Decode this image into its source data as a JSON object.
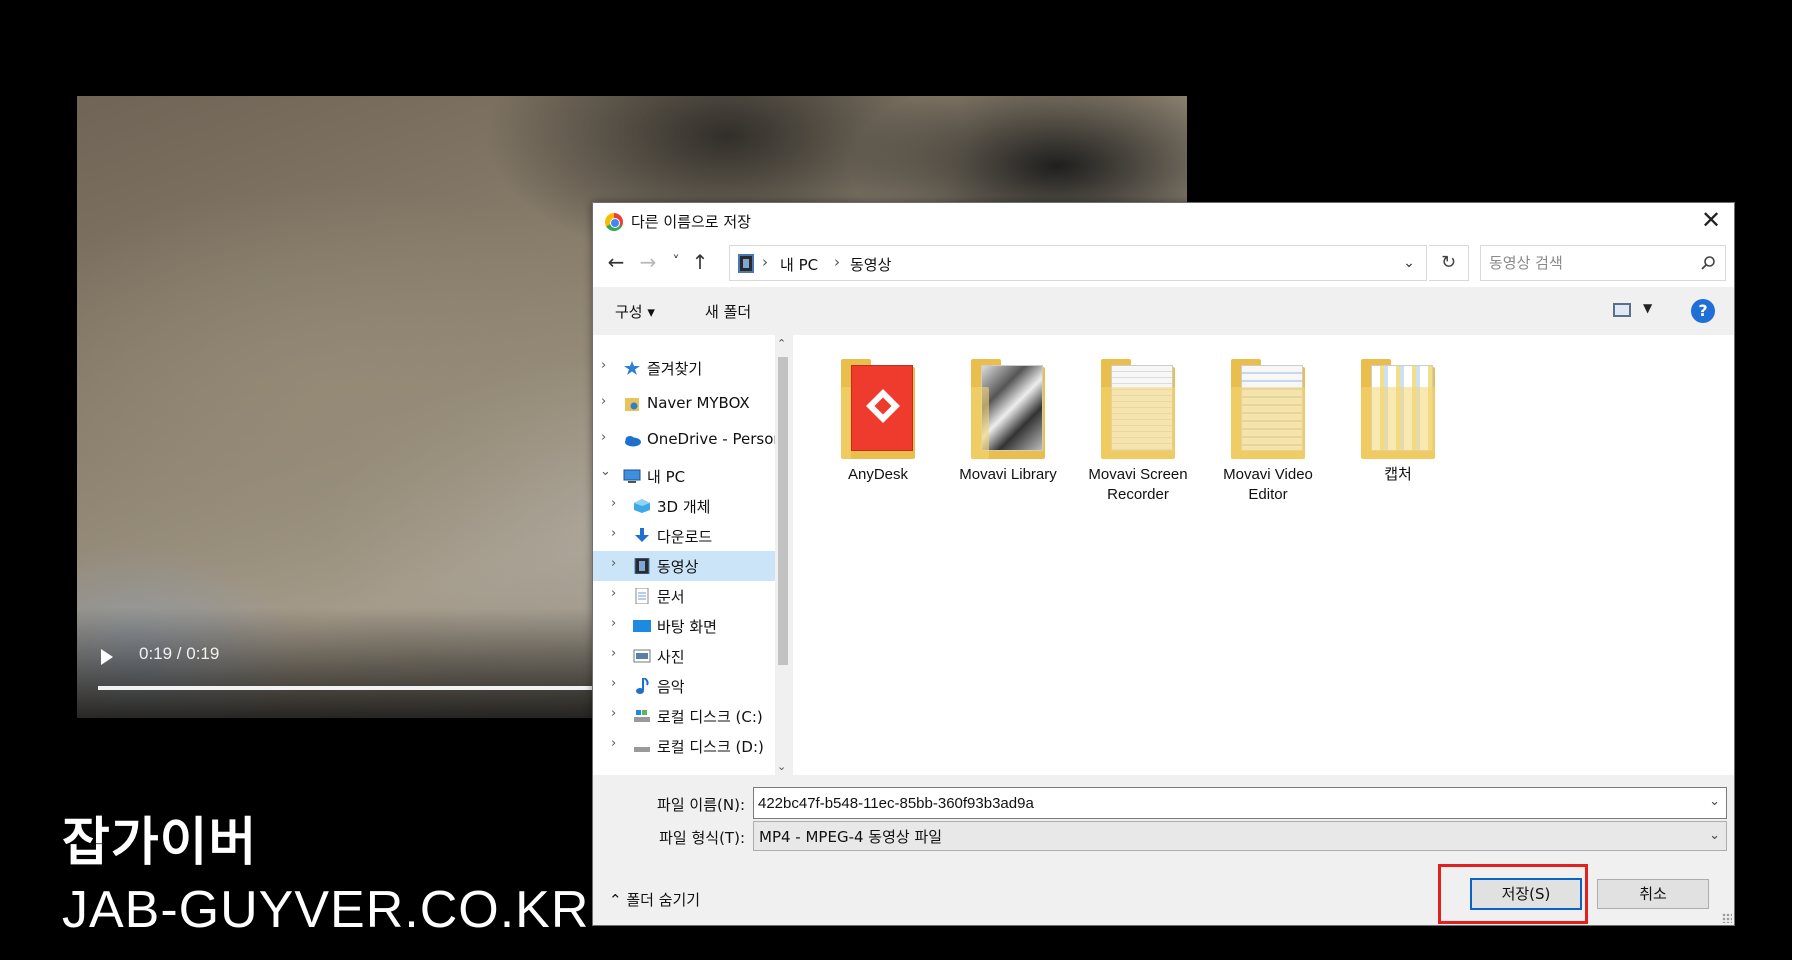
{
  "video": {
    "time": "0:19 / 0:19",
    "progress_fraction": 1.0
  },
  "watermark": {
    "title": "잡가이버",
    "url": "JAB-GUYVER.CO.KR"
  },
  "dialog": {
    "title": "다른 이름으로 저장",
    "close_glyph": "✕",
    "nav": {
      "back_glyph": "←",
      "forward_glyph": "→",
      "recent_glyph": "˅",
      "up_glyph": "↑",
      "breadcrumb": [
        "내 PC",
        "동영상"
      ],
      "crumb_sep": "›",
      "refresh_glyph": "↻",
      "dropdown_glyph": "⌄",
      "search_placeholder": "동영상 검색"
    },
    "toolbar": {
      "organize": "구성 ▾",
      "new_folder": "새 폴더",
      "view_caret": "▼",
      "help": "?"
    },
    "tree": {
      "collapsed_arrow": "›",
      "expanded_arrow": "⌄",
      "scroll_up": "⌃",
      "scroll_down": "⌄",
      "items": [
        {
          "label": "즐겨찾기",
          "icon": "star-icon"
        },
        {
          "label": "Naver MYBOX",
          "icon": "mybox-icon"
        },
        {
          "label": "OneDrive - Personal",
          "icon": "onedrive-icon"
        },
        {
          "label": "내 PC",
          "icon": "pc-icon"
        },
        {
          "label": "3D 개체",
          "icon": "cube-icon"
        },
        {
          "label": "다운로드",
          "icon": "download-icon"
        },
        {
          "label": "동영상",
          "icon": "video-icon"
        },
        {
          "label": "문서",
          "icon": "document-icon"
        },
        {
          "label": "바탕 화면",
          "icon": "desktop-icon"
        },
        {
          "label": "사진",
          "icon": "picture-icon"
        },
        {
          "label": "음악",
          "icon": "music-icon"
        },
        {
          "label": "로컬 디스크 (C:)",
          "icon": "disk-icon"
        },
        {
          "label": "로컬 디스크 (D:)",
          "icon": "disk-icon"
        }
      ]
    },
    "folders": [
      {
        "name": "AnyDesk"
      },
      {
        "name": "Movavi Library"
      },
      {
        "name": "Movavi Screen Recorder"
      },
      {
        "name": "Movavi Video Editor"
      },
      {
        "name": "캡처"
      }
    ],
    "filename_label": "파일 이름(N):",
    "filename_value": "422bc47f-b548-11ec-85bb-360f93b3ad9a",
    "filetype_label": "파일 형식(T):",
    "filetype_value": "MP4 - MPEG-4 동영상 파일",
    "combo_caret": "⌄",
    "hide_folders": "⌃  폴더 숨기기",
    "save_label": "저장(S)",
    "cancel_label": "취소",
    "colors": {
      "accent_blue": "#0a64c8",
      "highlight_red": "#e32020",
      "selected_bg": "#cce4f7",
      "folder_yellow": "#f5d575"
    }
  }
}
